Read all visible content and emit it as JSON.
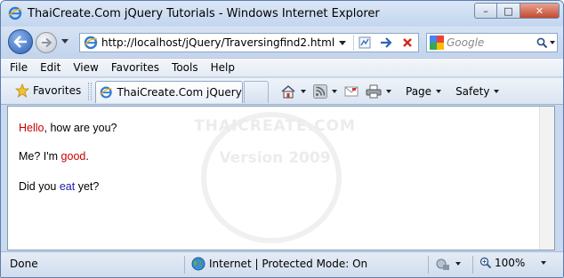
{
  "window": {
    "title": "ThaiCreate.Com jQuery Tutorials - Windows Internet Explorer",
    "min_glyph": "–",
    "max_glyph": "□",
    "close_glyph": "✕"
  },
  "addressbar": {
    "url": "http://localhost/jQuery/Traversingfind2.html"
  },
  "search": {
    "placeholder": "Google"
  },
  "menu": [
    "File",
    "Edit",
    "View",
    "Favorites",
    "Tools",
    "Help"
  ],
  "commandbar": {
    "favorites_label": "Favorites",
    "tab_title": "ThaiCreate.Com jQuery ...",
    "page_label": "Page",
    "safety_label": "Safety"
  },
  "content": {
    "line1": {
      "highlight": "Hello",
      "rest": ", how are you?"
    },
    "line2": {
      "before": "Me? I'm ",
      "highlight": "good",
      "after": "."
    },
    "line3": {
      "before": "Did you ",
      "highlight": "eat",
      "after": " yet?"
    },
    "watermark": {
      "line1": "THAICREATE.COM",
      "line2": "Version 2009"
    }
  },
  "status": {
    "text": "Done",
    "zone": "Internet | Protected Mode: On",
    "zoom": "100%"
  },
  "colors": {
    "highlight_red": "#cc0000",
    "highlight_blue": "#1a1ab0"
  },
  "icons": [
    "ie-logo-icon",
    "back-arrow-icon",
    "forward-arrow-icon",
    "compatibility-view-icon",
    "go-arrow-icon",
    "stop-icon",
    "google-logo-icon",
    "search-icon",
    "favorites-star-icon",
    "home-icon",
    "rss-feed-icon",
    "read-mail-icon",
    "print-icon",
    "globe-icon",
    "protected-mode-icon",
    "zoom-icon"
  ]
}
